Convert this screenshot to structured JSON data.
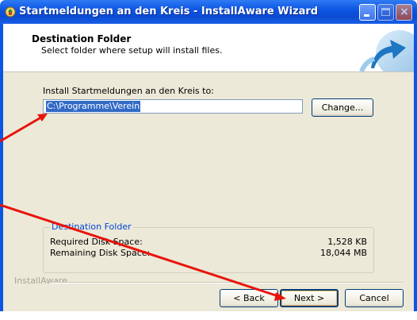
{
  "window": {
    "title": "Startmeldungen an den Kreis - InstallAware Wizard",
    "icon": "installer-icon",
    "controls": [
      "minimize-icon",
      "maximize-icon",
      "close-icon"
    ],
    "close_glyph": "×"
  },
  "header": {
    "title": "Destination Folder",
    "subtitle": "Select folder where setup will install files."
  },
  "install": {
    "label": "Install Startmeldungen an den Kreis to:",
    "path_value": "C:\\Programme\\Verein",
    "change_label": "Change..."
  },
  "disk": {
    "legend": "Destination Folder",
    "required_label": "Required Disk Space:",
    "required_value": "1,528 KB",
    "remaining_label": "Remaining Disk Space:",
    "remaining_value": "18,044 MB"
  },
  "footer": {
    "brand": "InstallAware",
    "back_label": "< Back",
    "next_label": "Next >",
    "cancel_label": "Cancel"
  },
  "annotations": {
    "arrow_color": "#e8140c"
  }
}
